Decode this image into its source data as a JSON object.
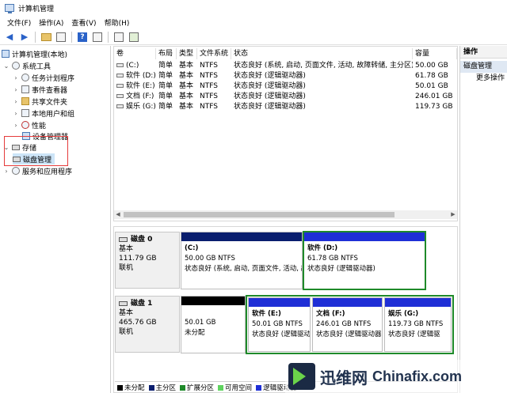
{
  "window": {
    "title": "计算机管理"
  },
  "menu": [
    "文件(F)",
    "操作(A)",
    "查看(V)",
    "帮助(H)"
  ],
  "tree": {
    "root": "计算机管理(本地)",
    "system_tools": "系统工具",
    "system_children": [
      "任务计划程序",
      "事件查看器",
      "共享文件夹",
      "本地用户和组",
      "性能",
      "设备管理器"
    ],
    "storage": "存储",
    "disk_mgmt": "磁盘管理",
    "services": "服务和应用程序"
  },
  "volume_list": {
    "headers": [
      "卷",
      "布局",
      "类型",
      "文件系统",
      "状态",
      "容量"
    ],
    "rows": [
      [
        "(C:)",
        "简单",
        "基本",
        "NTFS",
        "状态良好 (系统, 启动, 页面文件, 活动, 故障转储, 主分区)",
        "50.00 GB"
      ],
      [
        "软件 (D:)",
        "简单",
        "基本",
        "NTFS",
        "状态良好 (逻辑驱动器)",
        "61.78 GB"
      ],
      [
        "软件 (E:)",
        "简单",
        "基本",
        "NTFS",
        "状态良好 (逻辑驱动器)",
        "50.01 GB"
      ],
      [
        "文档 (F:)",
        "简单",
        "基本",
        "NTFS",
        "状态良好 (逻辑驱动器)",
        "246.01 GB"
      ],
      [
        "娱乐 (G:)",
        "简单",
        "基本",
        "NTFS",
        "状态良好 (逻辑驱动器)",
        "119.73 GB"
      ]
    ]
  },
  "disks": [
    {
      "name": "磁盘 0",
      "type": "基本",
      "size": "111.79 GB",
      "status": "联机",
      "partitions": [
        {
          "bar_color": "#0a1e6e",
          "title": "(C:)",
          "size": "50.00 GB NTFS",
          "status": "状态良好 (系统, 启动, 页面文件, 活动, 故障转储, 主分区)",
          "selected": false
        },
        {
          "bar_color": "#1f2fd6",
          "title": "软件 (D:)",
          "size": "61.78 GB NTFS",
          "status": "状态良好 (逻辑驱动器)",
          "selected": true
        }
      ]
    },
    {
      "name": "磁盘 1",
      "type": "基本",
      "size": "465.76 GB",
      "status": "联机",
      "partitions": [
        {
          "bar_color": "#000000",
          "title": "",
          "size": "50.01 GB",
          "status": "未分配",
          "selected": false
        },
        {
          "bar_color": "#1f2fd6",
          "title": "软件 (E:)",
          "size": "50.01 GB NTFS",
          "status": "状态良好 (逻辑驱动",
          "selected": true
        },
        {
          "bar_color": "#1f2fd6",
          "title": "文档 (F:)",
          "size": "246.01 GB NTFS",
          "status": "状态良好 (逻辑驱动器",
          "selected": true
        },
        {
          "bar_color": "#1f2fd6",
          "title": "娱乐 (G:)",
          "size": "119.73 GB NTFS",
          "status": "状态良好 (逻辑驱",
          "selected": true
        }
      ]
    }
  ],
  "legend": [
    {
      "label": "未分配",
      "color": "#000000"
    },
    {
      "label": "主分区",
      "color": "#0a1e6e"
    },
    {
      "label": "扩展分区",
      "color": "#1f8a2a"
    },
    {
      "label": "可用空间",
      "color": "#5fd35f"
    },
    {
      "label": "逻辑驱动器",
      "color": "#1f2fd6"
    }
  ],
  "actions": {
    "header": "操作",
    "section": "磁盘管理",
    "more": "更多操作"
  },
  "watermark": {
    "cn": "迅维网",
    "en": "Chinafix.com"
  }
}
